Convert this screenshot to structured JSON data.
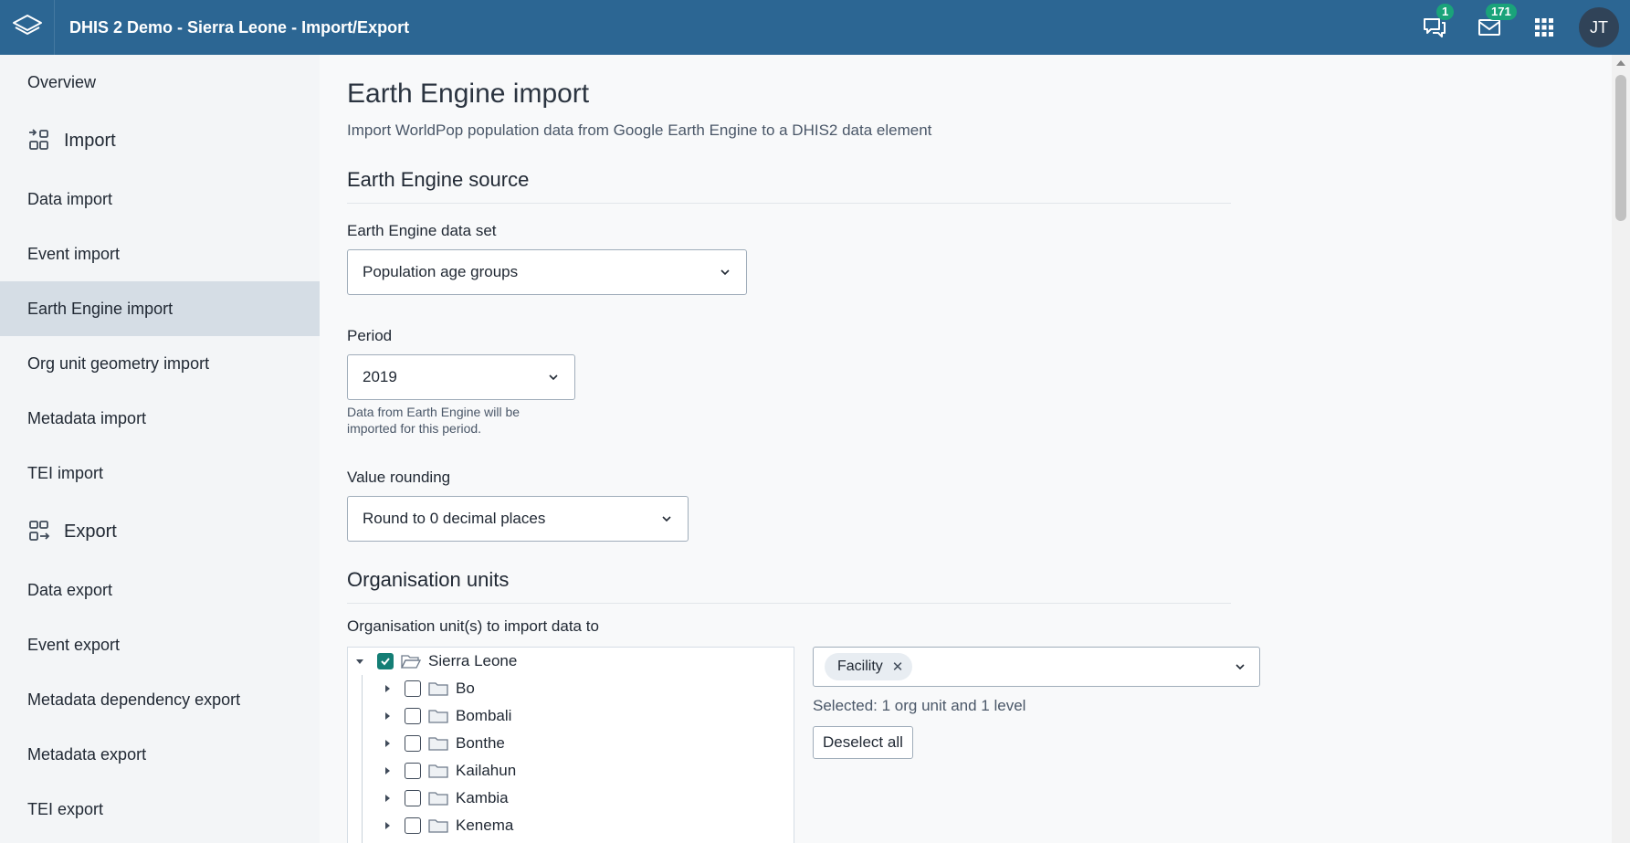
{
  "header": {
    "title": "DHIS 2 Demo - Sierra Leone - Import/Export",
    "interpretations_count": "1",
    "messages_count": "171",
    "avatar_initials": "JT",
    "icons": [
      "dhis2-logo-icon",
      "interpretations-icon",
      "messages-icon",
      "apps-grid-icon"
    ]
  },
  "sidebar": {
    "overview": "Overview",
    "import_heading": "Import",
    "import_items": [
      "Data import",
      "Event import",
      "Earth Engine import",
      "Org unit geometry import",
      "Metadata import",
      "TEI import"
    ],
    "export_heading": "Export",
    "export_items": [
      "Data export",
      "Event export",
      "Metadata dependency export",
      "Metadata export",
      "TEI export"
    ],
    "active_item": "Earth Engine import"
  },
  "main": {
    "title": "Earth Engine import",
    "subtitle": "Import WorldPop population data from Google Earth Engine to a DHIS2 data element",
    "source_section": "Earth Engine source",
    "dataset_label": "Earth Engine data set",
    "dataset_value": "Population age groups",
    "period_label": "Period",
    "period_value": "2019",
    "period_help": "Data from Earth Engine will be imported for this period.",
    "rounding_label": "Value rounding",
    "rounding_value": "Round to 0 decimal places",
    "org_section": "Organisation units",
    "org_label": "Organisation unit(s) to import data to",
    "tree_root": "Sierra Leone",
    "tree_children": [
      "Bo",
      "Bombali",
      "Bonthe",
      "Kailahun",
      "Kambia",
      "Kenema"
    ],
    "level_chip": "Facility",
    "selected_summary": "Selected: 1 org unit and 1 level",
    "deselect_label": "Deselect all"
  },
  "colors": {
    "header_bg": "#2c6693",
    "badge": "#1aa37a",
    "checkbox_checked": "#147e75",
    "active_nav": "#d5dde5"
  }
}
